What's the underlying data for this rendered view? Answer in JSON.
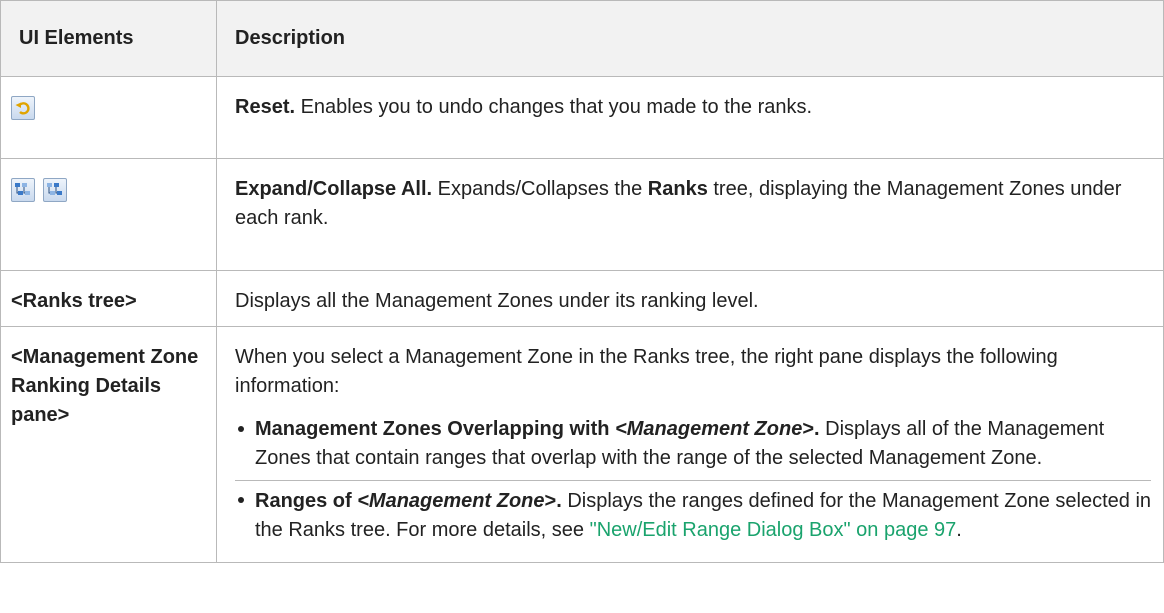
{
  "table": {
    "headers": [
      "UI Elements",
      "Description"
    ],
    "rows": {
      "reset": {
        "element_icon": "reset-undo-icon",
        "term": "Reset.",
        "text": " Enables you to undo changes that you made to the ranks."
      },
      "expand": {
        "element_icons": [
          "expand-all-icon",
          "collapse-all-icon"
        ],
        "term": "Expand/Collapse All.",
        "text_a": " Expands/Collapses the ",
        "bold_word": "Ranks",
        "text_b": " tree, displaying the Management Zones under each rank."
      },
      "ranks_tree": {
        "element": "<Ranks tree>",
        "text": "Displays all the Management Zones under its ranking level."
      },
      "details_pane": {
        "element": "<Management Zone Ranking Details pane>",
        "intro": "When you select a Management Zone in the Ranks tree, the right pane displays the following information:",
        "bullet1": {
          "term_a": "Management Zones Overlapping with ",
          "term_italic": "<Management Zone",
          "term_b": ">.",
          "text": " Displays all of the Management Zones that contain ranges that overlap with the range of the selected Management Zone."
        },
        "bullet2": {
          "term_a": "Ranges of ",
          "term_italic": "<Management Zone",
          "term_b": ">.",
          "text": " Displays the ranges defined for the Management Zone selected in the Ranks tree. For more details, see ",
          "link": "\"New/Edit Range Dialog Box\" on page 97",
          "end": "."
        }
      }
    }
  },
  "colors": {
    "header_bg": "#f2f2f2",
    "border": "#b9b9b9",
    "link": "#1aa36d"
  }
}
